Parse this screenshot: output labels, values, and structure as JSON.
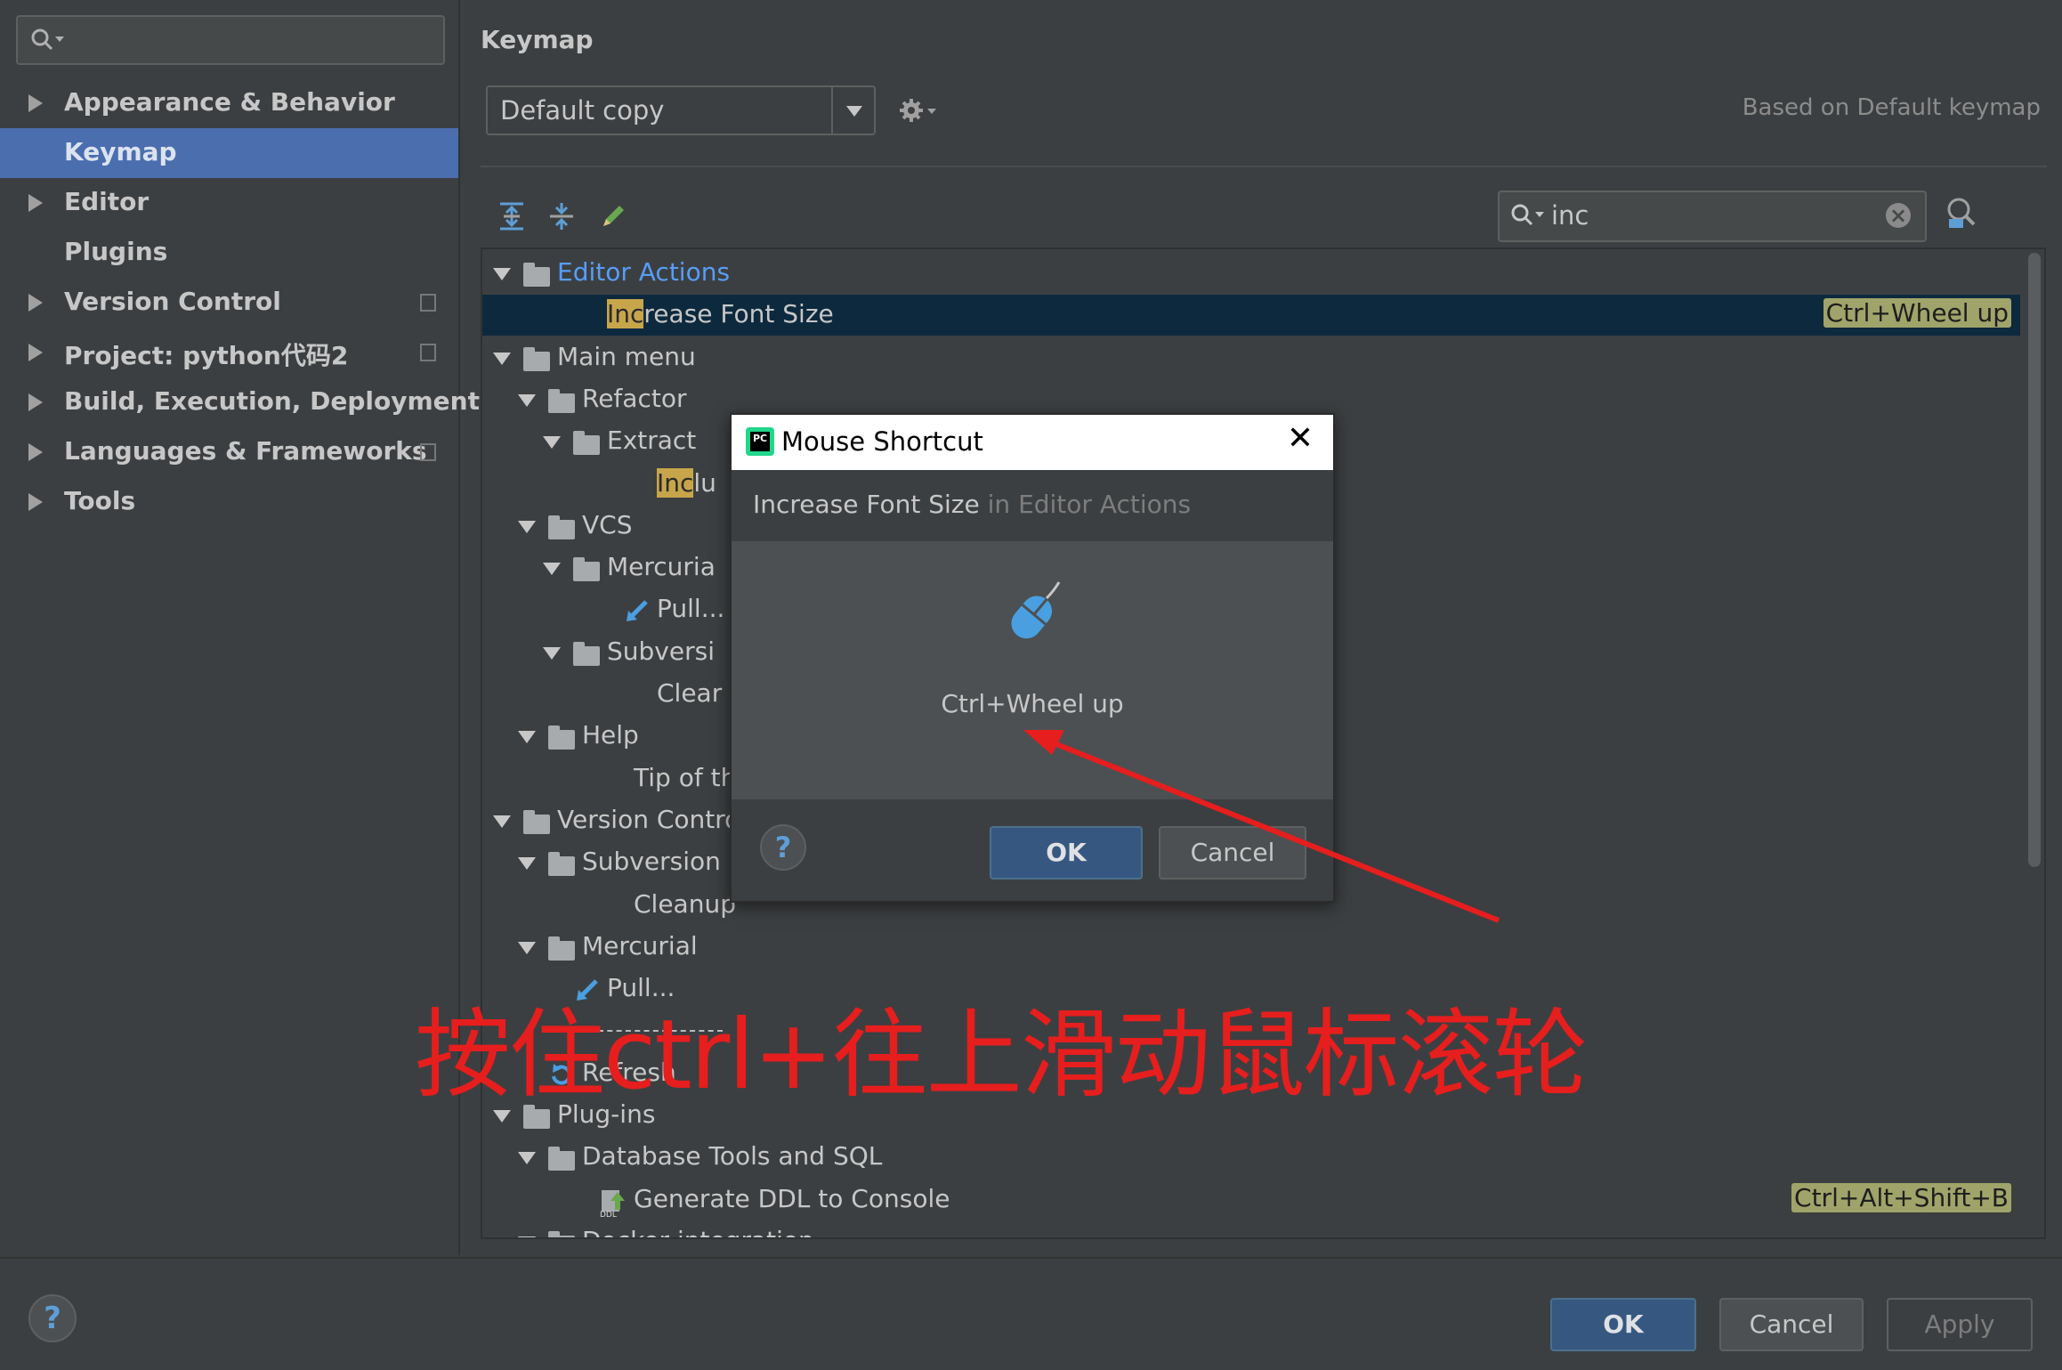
{
  "nav": {
    "search_placeholder": "",
    "items": [
      {
        "label": "Appearance & Behavior",
        "expandable": true,
        "selected": false,
        "icon": ""
      },
      {
        "label": "Keymap",
        "expandable": false,
        "selected": true,
        "icon": ""
      },
      {
        "label": "Editor",
        "expandable": true,
        "selected": false,
        "icon": ""
      },
      {
        "label": "Plugins",
        "expandable": false,
        "selected": false,
        "icon": ""
      },
      {
        "label": "Version Control",
        "expandable": true,
        "selected": false,
        "icon": "copy-icon"
      },
      {
        "label": "Project: python代码2",
        "expandable": true,
        "selected": false,
        "icon": "copy-icon"
      },
      {
        "label": "Build, Execution, Deployment",
        "expandable": true,
        "selected": false,
        "icon": ""
      },
      {
        "label": "Languages & Frameworks",
        "expandable": true,
        "selected": false,
        "icon": "copy-icon"
      },
      {
        "label": "Tools",
        "expandable": true,
        "selected": false,
        "icon": ""
      }
    ]
  },
  "keymap": {
    "title": "Keymap",
    "selected_keymap": "Default copy",
    "based_on": "Based on Default keymap",
    "search_value": "inc"
  },
  "tree": [
    {
      "label": "Editor Actions",
      "blue": true,
      "icon": "editor-actions-icon",
      "expand": true
    },
    {
      "label_hl": "Inc",
      "label_rest": "rease Font Size",
      "shortcut": "Ctrl+Wheel up",
      "selected": true
    },
    {
      "label": "Main menu",
      "icon": "menu-icon",
      "expand": true
    },
    {
      "label": "Refactor",
      "icon": "folder-icon",
      "expand": true
    },
    {
      "label": "Extract",
      "icon": "folder-icon",
      "expand": true
    },
    {
      "label_hl": "Inc",
      "label_rest": "lu"
    },
    {
      "label": "VCS",
      "icon": "folder-icon",
      "expand": true
    },
    {
      "label": "Mercuria",
      "icon": "folder-icon",
      "expand": true
    },
    {
      "label": "Pull...",
      "icon": "pull-icon"
    },
    {
      "label": "Subversi",
      "icon": "folder-icon",
      "expand": true
    },
    {
      "label": "Clear"
    },
    {
      "label": "Help",
      "icon": "folder-icon",
      "expand": true
    },
    {
      "label": "Tip of th"
    },
    {
      "label": "Version Contro",
      "icon": "folder-icon",
      "expand": true
    },
    {
      "label": "Subversion",
      "icon": "folder-icon",
      "expand": true
    },
    {
      "label": "Cleanup"
    },
    {
      "label": "Mercurial",
      "icon": "folder-icon",
      "expand": true
    },
    {
      "label": "Pull...",
      "icon": "pull-icon"
    },
    {
      "label": ""
    },
    {
      "label": "Refresh",
      "icon": "refresh-icon"
    },
    {
      "label": "Plug-ins",
      "icon": "folder-icon",
      "expand": true
    },
    {
      "label": "Database Tools and SQL",
      "icon": "folder-icon",
      "expand": true
    },
    {
      "label": "Generate DDL to Console",
      "icon": "ddl-icon",
      "shortcut": "Ctrl+Alt+Shift+B"
    },
    {
      "label": "Docker integration",
      "icon": "folder-icon",
      "expand": true
    }
  ],
  "dialog": {
    "title": "Mouse Shortcut",
    "action": "Increase Font Size",
    "context": "in Editor Actions",
    "shortcut": "Ctrl+Wheel up",
    "ok": "OK",
    "cancel": "Cancel",
    "help": "?"
  },
  "annotation": "按住ctrl+往上滑动鼠标滚轮",
  "buttons": {
    "help": "?",
    "ok": "OK",
    "cancel": "Cancel",
    "apply": "Apply"
  },
  "colors": {
    "background": "#3c3f41",
    "selection": "#4b6eaf",
    "tree_selection": "#0d293e",
    "highlight": "#c7a54a",
    "annotation": "#e61e1e"
  }
}
